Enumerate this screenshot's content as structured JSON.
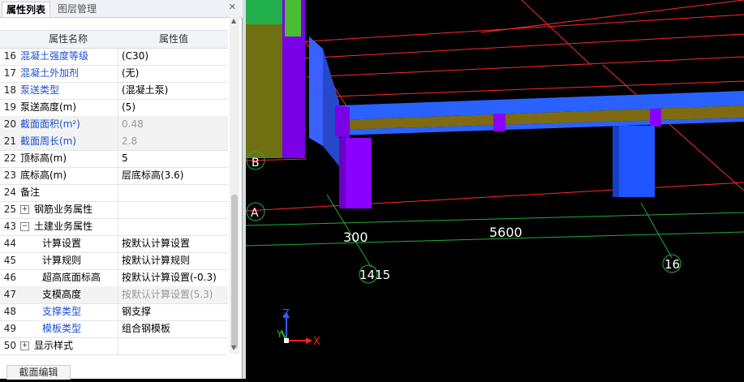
{
  "tabs": [
    {
      "label": "属性列表"
    },
    {
      "label": "图层管理"
    }
  ],
  "grid_header": {
    "name": "属性名称",
    "value": "属性值"
  },
  "rows": [
    {
      "num": "16",
      "name": "混凝土强度等级",
      "value": "(C30)",
      "name_color": "blue"
    },
    {
      "num": "17",
      "name": "混凝土外加剂",
      "value": "(无)",
      "name_color": "blue"
    },
    {
      "num": "18",
      "name": "泵送类型",
      "value": "(混凝土泵)",
      "name_color": "blue"
    },
    {
      "num": "19",
      "name": "泵送高度(m)",
      "value": "(5)",
      "name_color": "black"
    },
    {
      "num": "20",
      "name": "截面面积(m²)",
      "value": "0.48",
      "name_color": "blue",
      "grey": true
    },
    {
      "num": "21",
      "name": "截面周长(m)",
      "value": "2.8",
      "name_color": "blue",
      "grey": true
    },
    {
      "num": "22",
      "name": "顶标高(m)",
      "value": "5",
      "name_color": "black"
    },
    {
      "num": "23",
      "name": "底标高(m)",
      "value": "层底标高(3.6)",
      "name_color": "black"
    },
    {
      "num": "24",
      "name": "备注",
      "value": "",
      "name_color": "black"
    },
    {
      "num": "25",
      "name": "钢筋业务属性",
      "value": "",
      "expander": "+",
      "name_color": "black"
    },
    {
      "num": "43",
      "name": "土建业务属性",
      "value": "",
      "expander": "−",
      "name_color": "black"
    },
    {
      "num": "44",
      "name": "计算设置",
      "value": "按默认计算设置",
      "indent": true,
      "name_color": "black"
    },
    {
      "num": "45",
      "name": "计算规则",
      "value": "按默认计算规则",
      "indent": true,
      "name_color": "black"
    },
    {
      "num": "46",
      "name": "超高底面标高",
      "value": "按默认计算设置(-0.3)",
      "indent": true,
      "name_color": "black"
    },
    {
      "num": "47",
      "name": "支模高度",
      "value": "按默认计算设置(5.3)",
      "indent": true,
      "name_color": "black",
      "grey": true
    },
    {
      "num": "48",
      "name": "支撑类型",
      "value": "钢支撑",
      "indent": true,
      "name_color": "blue"
    },
    {
      "num": "49",
      "name": "模板类型",
      "value": "组合钢模板",
      "indent": true,
      "name_color": "blue"
    },
    {
      "num": "50",
      "name": "显示样式",
      "value": "",
      "expander": "+",
      "name_color": "black"
    }
  ],
  "bottom_tab": "截面编辑",
  "viewport": {
    "dims": {
      "d300": "300",
      "d5600": "5600"
    },
    "axis_bubbles": {
      "A": "A",
      "B": "B",
      "n1415": "1415",
      "n16": "16"
    },
    "axes": {
      "x": "X",
      "y": "Y",
      "z": "Z"
    }
  },
  "colors": {
    "blue_text": "#1b4fd1",
    "beam_gold": "#7d6a12",
    "beam_blue": "#2a62ff",
    "column_purple": "#8a00ff",
    "column_blue": "#1f55ff",
    "grid_red": "#ff2a2a",
    "grid_green": "#1fae3a"
  }
}
